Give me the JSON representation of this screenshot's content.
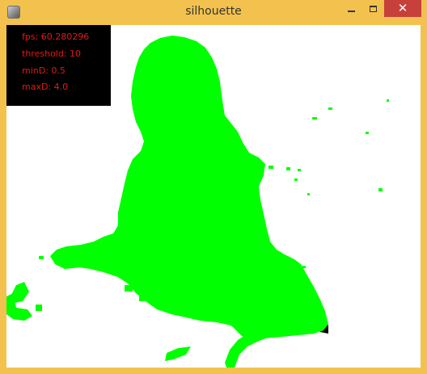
{
  "window": {
    "title": "silhouette",
    "app_icon": "app-window-icon",
    "controls": {
      "minimize": "minimize-icon",
      "maximize": "maximize-icon",
      "close": "close-icon",
      "close_glyph": "✕"
    },
    "frame_color": "#f3c24e",
    "close_color": "#c7403a"
  },
  "overlay": {
    "fps_text": "fps: 60.280296",
    "threshold_text": "threshold: 10",
    "mind_text": "minD: 0.5",
    "maxd_text": "maxD: 4.0",
    "text_color": "#e01a1a",
    "background": "#000000"
  },
  "canvas": {
    "background": "#ffffff",
    "silhouette_color": "#00ff00",
    "shadow_color": "#000000"
  }
}
